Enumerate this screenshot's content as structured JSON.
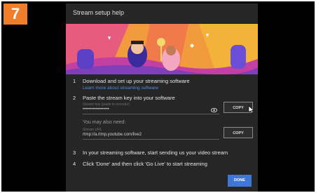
{
  "step_badge": "7",
  "dialog": {
    "title": "Stream setup help",
    "steps": [
      {
        "num": "1",
        "text": "Download and set up your streaming software",
        "link": "Learn more about streaming software"
      },
      {
        "num": "2",
        "text": "Paste the stream key into your software"
      },
      {
        "num": "3",
        "text": "In your streaming software, start sending us your video stream"
      },
      {
        "num": "4",
        "text": "Click 'Done' and then click 'Go Live' to start streaming"
      }
    ],
    "stream_key": {
      "hint": "Stream key (paste in encoder)",
      "value": "••••••••••••••••••",
      "copy_label": "COPY"
    },
    "may_need": "You may also need:",
    "stream_url": {
      "hint": "Stream URL",
      "value": "rtmp://a.rtmp.youtube.com/live2",
      "copy_label": "COPY"
    },
    "done_label": "DONE"
  }
}
